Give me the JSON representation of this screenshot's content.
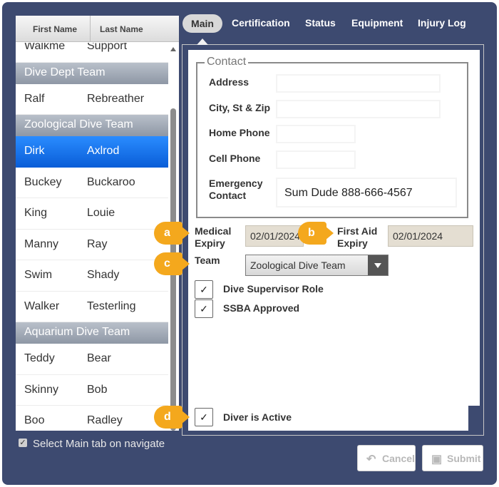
{
  "list": {
    "headers": {
      "first_name": "First Name",
      "last_name": "Last Name"
    },
    "items": [
      {
        "type": "row",
        "first": "Walkme",
        "last": "Support"
      },
      {
        "type": "group",
        "label": "Dive Dept Team"
      },
      {
        "type": "row",
        "first": "Ralf",
        "last": "Rebreather"
      },
      {
        "type": "group",
        "label": "Zoological Dive Team"
      },
      {
        "type": "row",
        "first": "Dirk",
        "last": "Axlrod",
        "selected": true
      },
      {
        "type": "row",
        "first": "Buckey",
        "last": "Buckaroo"
      },
      {
        "type": "row",
        "first": "King",
        "last": "Louie"
      },
      {
        "type": "row",
        "first": "Manny",
        "last": "Ray"
      },
      {
        "type": "row",
        "first": "Swim",
        "last": "Shady"
      },
      {
        "type": "row",
        "first": "Walker",
        "last": "Testerling"
      },
      {
        "type": "group",
        "label": "Aquarium Dive Team"
      },
      {
        "type": "row",
        "first": "Teddy",
        "last": "Bear"
      },
      {
        "type": "row",
        "first": "Skinny",
        "last": "Bob"
      },
      {
        "type": "row",
        "first": "Boo",
        "last": "Radley"
      }
    ],
    "nav_option": {
      "label": "Select Main tab on navigate",
      "checked": true
    }
  },
  "tabs": [
    "Main",
    "Certification",
    "Status",
    "Equipment",
    "Injury Log"
  ],
  "form": {
    "contact_legend": "Contact",
    "address_label": "Address",
    "address_value": "",
    "city_label": "City, St & Zip",
    "city_value": "",
    "home_phone_label": "Home Phone",
    "home_phone_value": "",
    "cell_phone_label": "Cell Phone",
    "cell_phone_value": "",
    "emergency_label_1": "Emergency",
    "emergency_label_2": "Contact",
    "emergency_value": "Sum Dude 888-666-4567",
    "medical_label_1": "Medical",
    "medical_label_2": "Expiry",
    "medical_value": "02/01/2024",
    "first_aid_label_1": "First Aid",
    "first_aid_label_2": "Expiry",
    "first_aid_value": "02/01/2024",
    "team_label": "Team",
    "team_value": "Zoological Dive Team",
    "dive_supervisor_label": "Dive Supervisor Role",
    "ssba_label": "SSBA Approved",
    "diver_active_label": "Diver is Active",
    "check_mark": "✓"
  },
  "callouts": {
    "a": "a",
    "b": "b",
    "c": "c",
    "d": "d"
  },
  "buttons": {
    "cancel_label": "Cancel",
    "submit_label": "Submit",
    "cancel_icon": "undo-arrow-icon",
    "submit_icon": "floppy-disk-icon"
  },
  "colors": {
    "frame_bg": "#3d4a70",
    "selected_row": "#0a5ed8",
    "callout": "#f4a81d",
    "group_header": "#9aa2ae"
  }
}
